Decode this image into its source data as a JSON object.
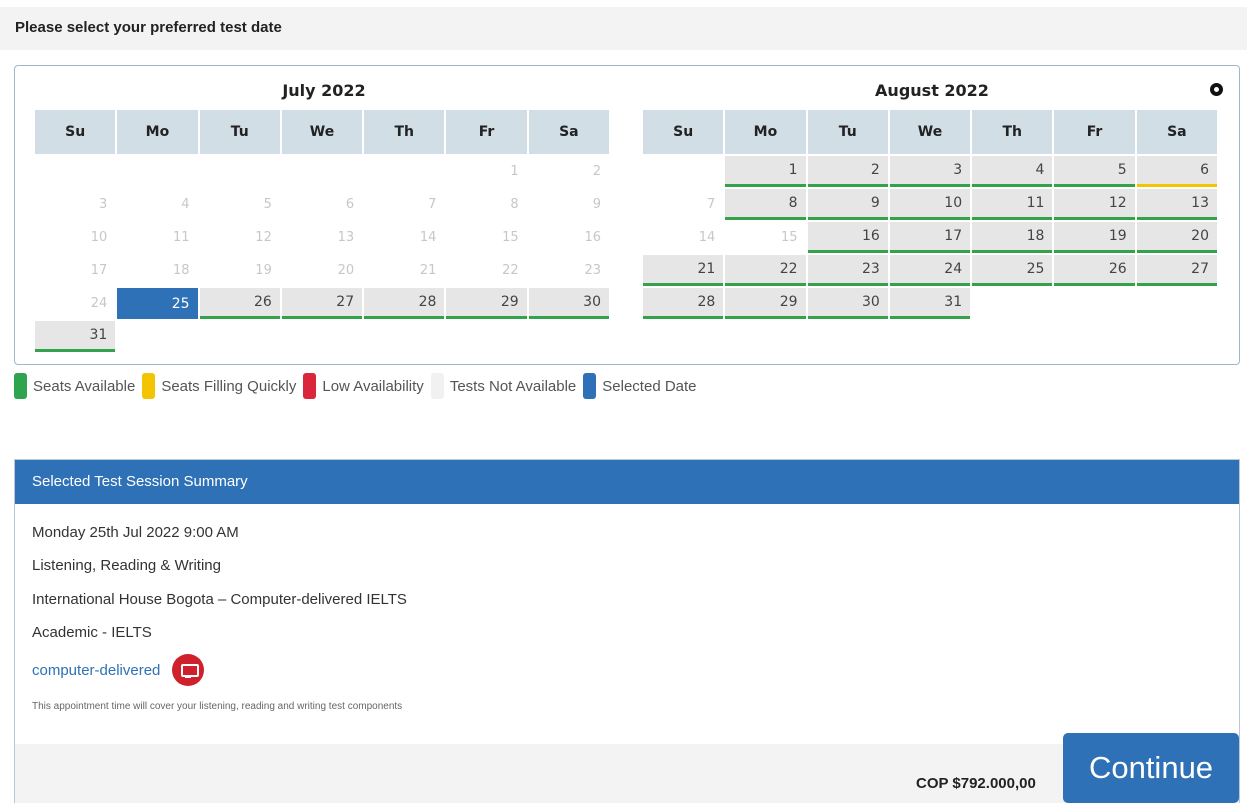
{
  "header": {
    "title": "Please select your preferred test date"
  },
  "calendar": {
    "weekdays": [
      "Su",
      "Mo",
      "Tu",
      "We",
      "Th",
      "Fr",
      "Sa"
    ],
    "months": [
      {
        "title": "July 2022",
        "weeks": [
          [
            null,
            null,
            null,
            null,
            null,
            {
              "d": "1",
              "s": "off"
            },
            {
              "d": "2",
              "s": "off"
            }
          ],
          [
            {
              "d": "3",
              "s": "off"
            },
            {
              "d": "4",
              "s": "off"
            },
            {
              "d": "5",
              "s": "off"
            },
            {
              "d": "6",
              "s": "off"
            },
            {
              "d": "7",
              "s": "off"
            },
            {
              "d": "8",
              "s": "off"
            },
            {
              "d": "9",
              "s": "off"
            }
          ],
          [
            {
              "d": "10",
              "s": "off"
            },
            {
              "d": "11",
              "s": "off"
            },
            {
              "d": "12",
              "s": "off"
            },
            {
              "d": "13",
              "s": "off"
            },
            {
              "d": "14",
              "s": "off"
            },
            {
              "d": "15",
              "s": "off"
            },
            {
              "d": "16",
              "s": "off"
            }
          ],
          [
            {
              "d": "17",
              "s": "off"
            },
            {
              "d": "18",
              "s": "off"
            },
            {
              "d": "19",
              "s": "off"
            },
            {
              "d": "20",
              "s": "off"
            },
            {
              "d": "21",
              "s": "off"
            },
            {
              "d": "22",
              "s": "off"
            },
            {
              "d": "23",
              "s": "off"
            }
          ],
          [
            {
              "d": "24",
              "s": "off"
            },
            {
              "d": "25",
              "s": "sel"
            },
            {
              "d": "26",
              "s": "avail"
            },
            {
              "d": "27",
              "s": "avail"
            },
            {
              "d": "28",
              "s": "avail"
            },
            {
              "d": "29",
              "s": "avail"
            },
            {
              "d": "30",
              "s": "avail"
            }
          ],
          [
            {
              "d": "31",
              "s": "avail"
            },
            null,
            null,
            null,
            null,
            null,
            null
          ]
        ]
      },
      {
        "title": "August 2022",
        "weeks": [
          [
            null,
            {
              "d": "1",
              "s": "avail"
            },
            {
              "d": "2",
              "s": "avail"
            },
            {
              "d": "3",
              "s": "avail"
            },
            {
              "d": "4",
              "s": "avail"
            },
            {
              "d": "5",
              "s": "avail"
            },
            {
              "d": "6",
              "s": "fill"
            }
          ],
          [
            {
              "d": "7",
              "s": "off"
            },
            {
              "d": "8",
              "s": "avail"
            },
            {
              "d": "9",
              "s": "avail"
            },
            {
              "d": "10",
              "s": "avail"
            },
            {
              "d": "11",
              "s": "avail"
            },
            {
              "d": "12",
              "s": "avail"
            },
            {
              "d": "13",
              "s": "avail"
            }
          ],
          [
            {
              "d": "14",
              "s": "off"
            },
            {
              "d": "15",
              "s": "off"
            },
            {
              "d": "16",
              "s": "avail"
            },
            {
              "d": "17",
              "s": "avail"
            },
            {
              "d": "18",
              "s": "avail"
            },
            {
              "d": "19",
              "s": "avail"
            },
            {
              "d": "20",
              "s": "avail"
            }
          ],
          [
            {
              "d": "21",
              "s": "avail"
            },
            {
              "d": "22",
              "s": "avail"
            },
            {
              "d": "23",
              "s": "avail"
            },
            {
              "d": "24",
              "s": "avail"
            },
            {
              "d": "25",
              "s": "avail"
            },
            {
              "d": "26",
              "s": "avail"
            },
            {
              "d": "27",
              "s": "avail"
            }
          ],
          [
            {
              "d": "28",
              "s": "avail"
            },
            {
              "d": "29",
              "s": "avail"
            },
            {
              "d": "30",
              "s": "avail"
            },
            {
              "d": "31",
              "s": "avail"
            },
            null,
            null,
            null
          ]
        ]
      }
    ],
    "next_icon": "circle-next-icon"
  },
  "legend": [
    {
      "label": "Seats Available",
      "color": "#2ea44f"
    },
    {
      "label": "Seats Filling Quickly",
      "color": "#f5c400"
    },
    {
      "label": "Low Availability",
      "color": "#d9263a"
    },
    {
      "label": "Tests Not Available",
      "color": "#f1f1f1"
    },
    {
      "label": "Selected Date",
      "color": "#2e71b6"
    }
  ],
  "summary": {
    "title": "Selected Test Session Summary",
    "date": "Monday 25th Jul 2022 9:00 AM",
    "components": "Listening, Reading & Writing",
    "venue": "International House Bogota – Computer-delivered IELTS",
    "test_type": "Academic - IELTS",
    "delivery_link": "computer-delivered",
    "delivery_icon": "monitor-icon",
    "note": "This appointment time will cover your listening, reading and writing test components",
    "price": "COP $792.000,00"
  },
  "actions": {
    "continue_label": "Continue"
  }
}
